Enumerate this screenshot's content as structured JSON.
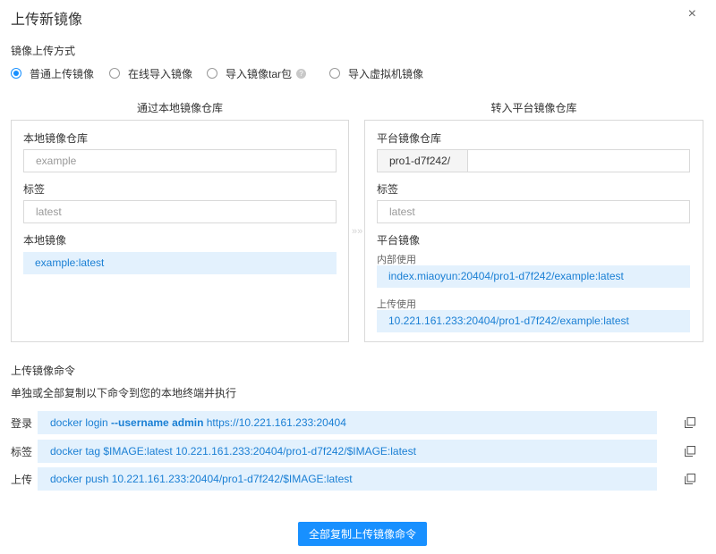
{
  "dialog": {
    "title": "上传新镜像",
    "close_glyph": "×"
  },
  "upload_method": {
    "label": "镜像上传方式",
    "options": [
      {
        "label": "普通上传镜像",
        "checked": true
      },
      {
        "label": "在线导入镜像",
        "checked": false
      },
      {
        "label": "导入镜像tar包",
        "checked": false,
        "help_icon": "question-circle-icon"
      },
      {
        "label": "导入虚拟机镜像",
        "checked": false
      }
    ]
  },
  "local_pane": {
    "heading": "通过本地镜像仓库",
    "repo_label": "本地镜像仓库",
    "repo_placeholder": "example",
    "tag_label": "标签",
    "tag_placeholder": "latest",
    "image_label": "本地镜像",
    "image_value": "example:latest"
  },
  "platform_pane": {
    "heading": "转入平台镜像仓库",
    "repo_label": "平台镜像仓库",
    "repo_prefix": "pro1-d7f242/",
    "repo_value": "",
    "tag_label": "标签",
    "tag_placeholder": "latest",
    "image_label": "平台镜像",
    "internal_label": "内部使用",
    "internal_value": "index.miaoyun:20404/pro1-d7f242/example:latest",
    "upload_label": "上传使用",
    "upload_value": "10.221.161.233:20404/pro1-d7f242/example:latest"
  },
  "commands": {
    "label": "上传镜像命令",
    "hint": "单独或全部复制以下命令到您的本地终端并执行",
    "rows": [
      {
        "label": "登录",
        "prefix": "docker login ",
        "bold": "--username admin",
        "suffix": " https://10.221.161.233:20404"
      },
      {
        "label": "标签",
        "text": "docker tag $IMAGE:latest 10.221.161.233:20404/pro1-d7f242/$IMAGE:latest"
      },
      {
        "label": "上传",
        "text": "docker push 10.221.161.233:20404/pro1-d7f242/$IMAGE:latest"
      }
    ],
    "copy_all_label": "全部复制上传镜像命令"
  },
  "colors": {
    "accent": "#1890ff",
    "field_bg": "#e3f1fd",
    "field_text": "#1a7fd4"
  }
}
